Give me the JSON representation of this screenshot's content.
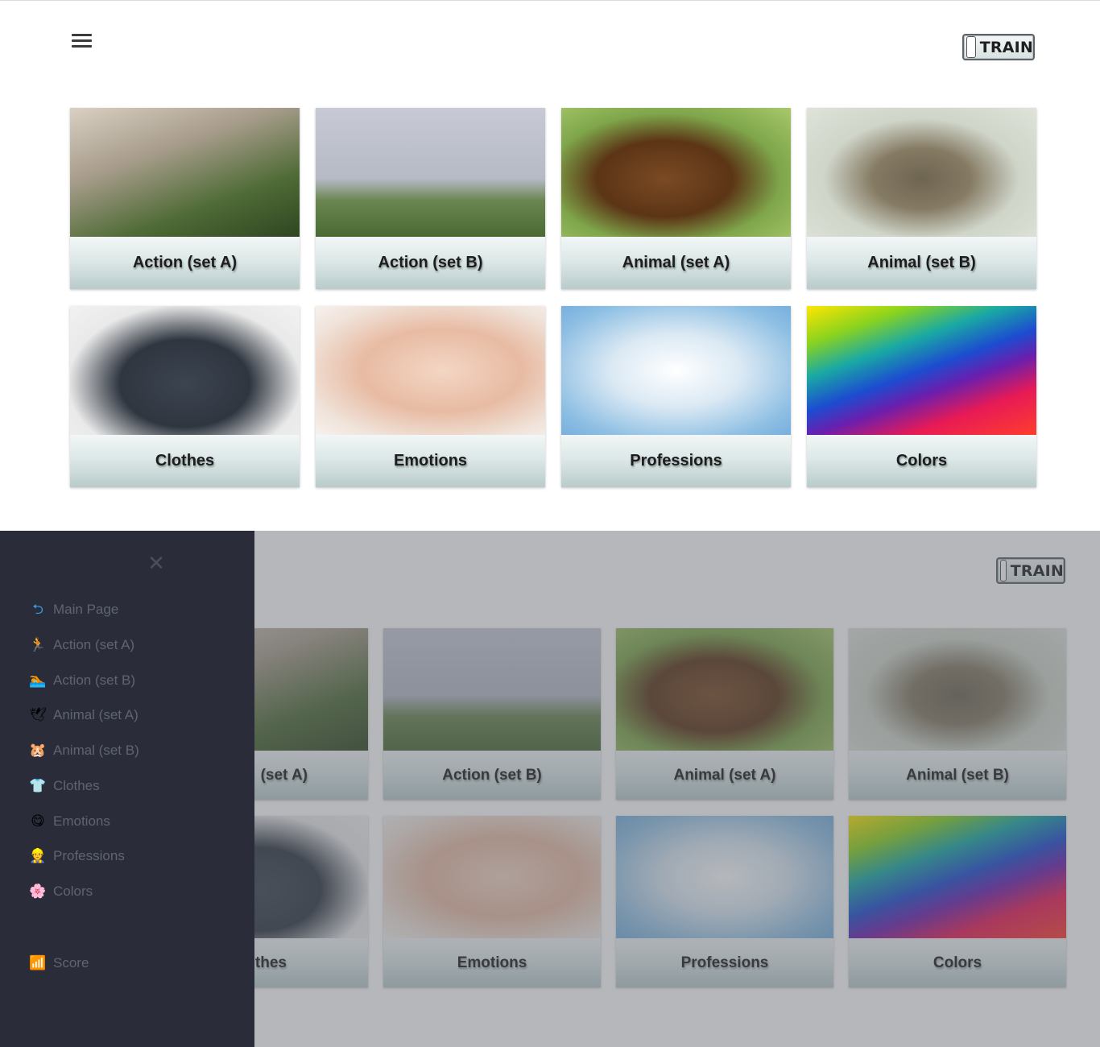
{
  "app": {
    "train_label": "TRAIN"
  },
  "categories": [
    {
      "label": "Action (set A)",
      "icon": "running-person-icon"
    },
    {
      "label": "Action (set B)",
      "icon": "swimmer-icon"
    },
    {
      "label": "Animal (set A)",
      "icon": "bird-icon"
    },
    {
      "label": "Animal (set B)",
      "icon": "hamster-icon"
    },
    {
      "label": "Clothes",
      "icon": "tshirt-icon"
    },
    {
      "label": "Emotions",
      "icon": "smiley-icon"
    },
    {
      "label": "Professions",
      "icon": "worker-icon"
    },
    {
      "label": "Colors",
      "icon": "color-wheel-icon"
    }
  ],
  "drawer": {
    "main_page": "Main Page",
    "items": [
      {
        "label": "Action (set A)",
        "glyph": "🏃"
      },
      {
        "label": "Action (set B)",
        "glyph": "🏊"
      },
      {
        "label": "Animal (set A)",
        "glyph": "🕊"
      },
      {
        "label": "Animal (set B)",
        "glyph": "🐹"
      },
      {
        "label": "Clothes",
        "glyph": "👕"
      },
      {
        "label": "Emotions",
        "glyph": "😋"
      },
      {
        "label": "Professions",
        "glyph": "👷"
      },
      {
        "label": "Colors",
        "glyph": "🌸"
      }
    ],
    "score": "Score",
    "close_glyph": "✕",
    "main_page_glyph": "⮌",
    "score_glyph": "📶"
  },
  "bottom_partial": {
    "action_a_fragment": "(set A)",
    "clothes_fragment": "thes"
  }
}
